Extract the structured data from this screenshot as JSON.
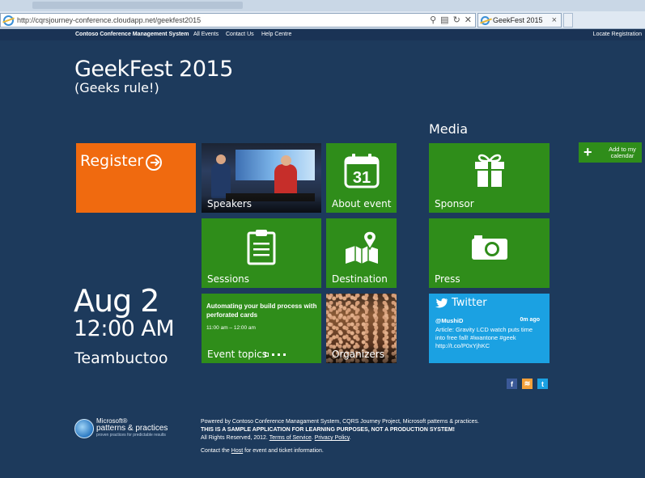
{
  "browser": {
    "url": "http://cqrsjourney-conference.cloudapp.net/geekfest2015",
    "tab_title": "GeekFest 2015",
    "tab_close": "×"
  },
  "nav": {
    "brand": "Contoso Conference Management System",
    "items": [
      "All Events",
      "Contact Us",
      "Help Centre"
    ],
    "right": "Locate Registration"
  },
  "event": {
    "title": "GeekFest 2015",
    "subtitle": "(Geeks rule!)",
    "date": "Aug 2",
    "time": "12:00 AM",
    "location": "Teambuctoo"
  },
  "media_heading": "Media",
  "tiles": {
    "register": "Register",
    "speakers": "Speakers",
    "about": "About event",
    "calendar_day": "31",
    "sponsor": "Sponsor",
    "sessions": "Sessions",
    "destination": "Destination",
    "press": "Press",
    "event_topics": "Event topics",
    "organizers": "Organizers"
  },
  "topic": {
    "title": "Automating your build process with perforated cards",
    "time": "11:00 am – 12:00 am"
  },
  "twitter": {
    "heading": "Twitter",
    "user": "@MushiD",
    "time": "0m ago",
    "text": "Article: Gravity LCD watch puts time into free fall! #iwantone #geek http://t.co/P0xYjhKC"
  },
  "calendar_button": {
    "plus": "+",
    "label": "Add to my calendar"
  },
  "social": {
    "facebook": "f",
    "rss": "≋",
    "twitter": "t"
  },
  "logo": {
    "line1": "Microsoft®",
    "line2": "patterns & practices",
    "line3": "proven practices for predictable results"
  },
  "footer": {
    "powered": "Powered by Contoso Conference Managament System, CQRS Journey Project, Microsoft patterns & practices.",
    "warning": "THIS IS A SAMPLE APPLICATION FOR LEARNING PURPOSES, NOT A PRODUCTION SYSTEM!",
    "rights": "All Rights Reserved, 2012.",
    "terms": "Terms of Service",
    "privacy": "Privacy Policy",
    "contact_pre": "Contact the",
    "contact_link": "Host",
    "contact_post": "for event and ticket information."
  },
  "colors": {
    "background": "#1d3a5c",
    "tile_green": "#2f8d1a",
    "register_orange": "#f06a0f",
    "twitter_blue": "#1ba1e2"
  }
}
